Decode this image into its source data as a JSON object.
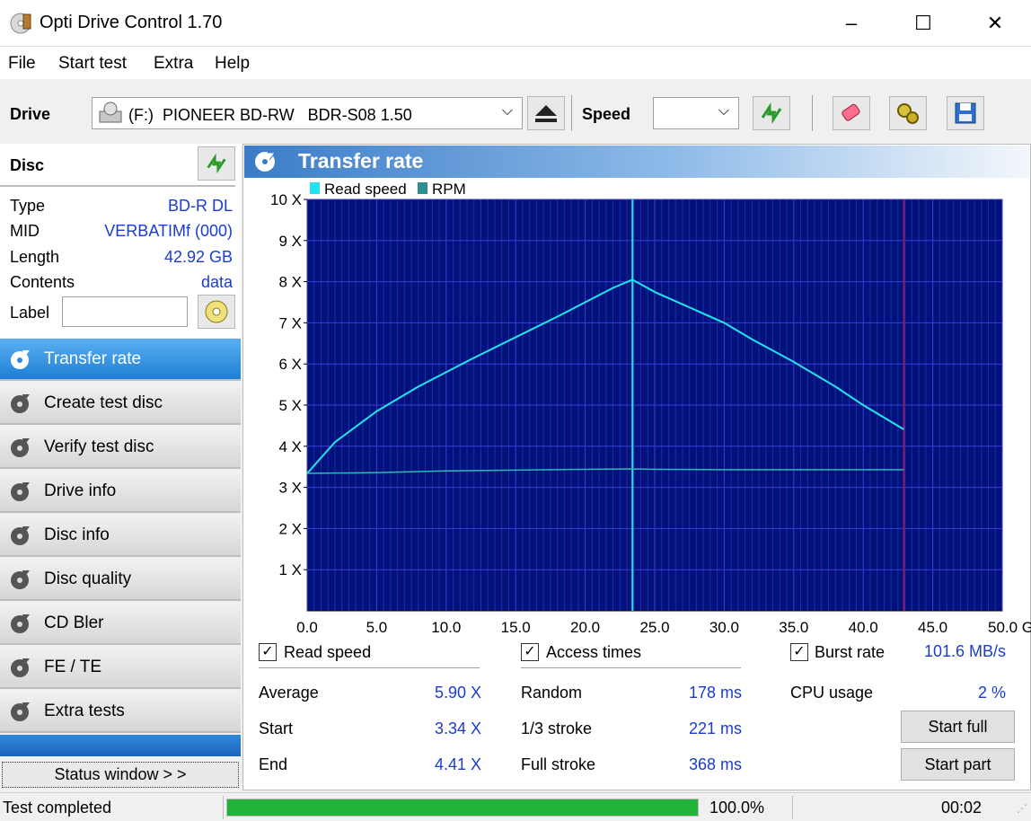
{
  "window": {
    "title": "Opti Drive Control 1.70",
    "minimize": "–",
    "maximize": "☐",
    "close": "✕"
  },
  "menu": {
    "file": "File",
    "start_test": "Start test",
    "extra": "Extra",
    "help": "Help"
  },
  "toolbar": {
    "drive_label": "Drive",
    "drive_value": "(F:)  PIONEER BD-RW   BDR-S08 1.50",
    "speed_label": "Speed",
    "speed_value": ""
  },
  "disc": {
    "title": "Disc",
    "type_label": "Type",
    "type_value": "BD-R DL",
    "mid_label": "MID",
    "mid_value": "VERBATIMf (000)",
    "length_label": "Length",
    "length_value": "42.92 GB",
    "contents_label": "Contents",
    "contents_value": "data",
    "label_label": "Label",
    "label_value": ""
  },
  "nav": [
    {
      "label": "Transfer rate"
    },
    {
      "label": "Create test disc"
    },
    {
      "label": "Verify test disc"
    },
    {
      "label": "Drive info"
    },
    {
      "label": "Disc info"
    },
    {
      "label": "Disc quality"
    },
    {
      "label": "CD Bler"
    },
    {
      "label": "FE / TE"
    },
    {
      "label": "Extra tests"
    }
  ],
  "status_window_button": "Status window > >",
  "panel": {
    "title": "Transfer rate"
  },
  "chart_data": {
    "type": "line",
    "legend": [
      "Read speed",
      "RPM"
    ],
    "legend_colors": [
      "#22e4f0",
      "#2e8f8f"
    ],
    "x_ticks": [
      "0.0",
      "5.0",
      "10.0",
      "15.0",
      "20.0",
      "25.0",
      "30.0",
      "35.0",
      "40.0",
      "45.0",
      "50.0 GB"
    ],
    "y_ticks": [
      "1 X",
      "2 X",
      "3 X",
      "4 X",
      "5 X",
      "6 X",
      "7 X",
      "8 X",
      "9 X",
      "10 X"
    ],
    "xlim": [
      0,
      50
    ],
    "ylim": [
      0,
      10
    ],
    "layer_break_gb": 23.4,
    "disc_end_gb": 42.92,
    "series": [
      {
        "name": "Read speed",
        "x": [
          0,
          2,
          5,
          8,
          10,
          12,
          15,
          18,
          20,
          22,
          23.4,
          25,
          28,
          30,
          32,
          35,
          38,
          40,
          42.92
        ],
        "y": [
          3.34,
          4.1,
          4.85,
          5.45,
          5.8,
          6.15,
          6.65,
          7.15,
          7.5,
          7.85,
          8.05,
          7.75,
          7.3,
          7.0,
          6.6,
          6.05,
          5.45,
          5.0,
          4.41
        ]
      },
      {
        "name": "RPM",
        "x": [
          0,
          5,
          10,
          15,
          20,
          23.4,
          25,
          30,
          35,
          40,
          42.92
        ],
        "y": [
          3.34,
          3.36,
          3.4,
          3.42,
          3.44,
          3.45,
          3.44,
          3.43,
          3.43,
          3.43,
          3.43
        ]
      }
    ]
  },
  "stats": {
    "read_speed_label": "Read speed",
    "access_times_label": "Access times",
    "burst_rate_label": "Burst rate",
    "burst_rate_value": "101.6 MB/s",
    "average_label": "Average",
    "average_value": "5.90 X",
    "start_label": "Start",
    "start_value": "3.34 X",
    "end_label": "End",
    "end_value": "4.41 X",
    "random_label": "Random",
    "random_value": "178 ms",
    "third_label": "1/3 stroke",
    "third_value": "221 ms",
    "full_label": "Full stroke",
    "full_value": "368 ms",
    "cpu_label": "CPU usage",
    "cpu_value": "2 %",
    "start_full_button": "Start full",
    "start_part_button": "Start part"
  },
  "status": {
    "text": "Test completed",
    "progress": 1.0,
    "progress_text": "100.0%",
    "time": "00:02",
    "progress_color": "#21b33a"
  }
}
